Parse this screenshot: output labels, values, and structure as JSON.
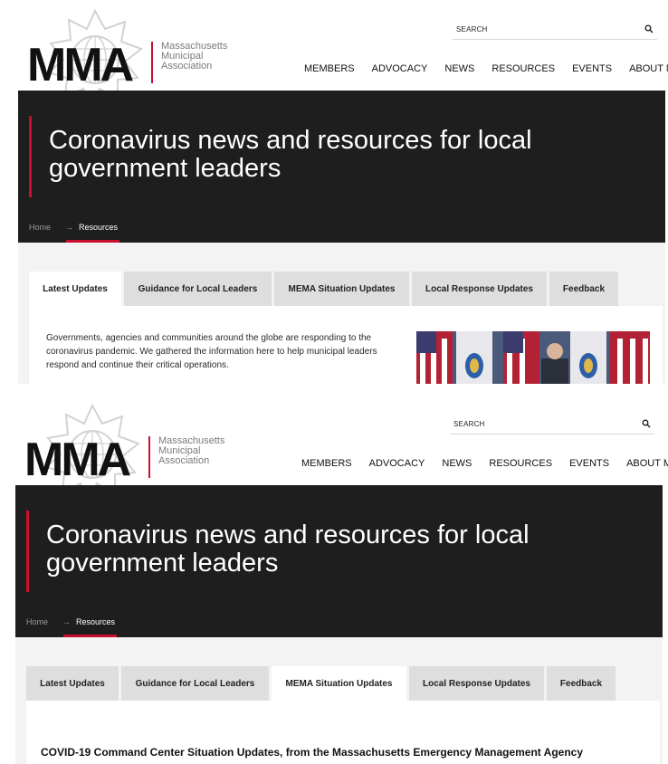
{
  "logo": {
    "mark": "MMA",
    "line1": "Massachusetts",
    "line2": "Municipal",
    "line3": "Association"
  },
  "search": {
    "label": "SEARCH"
  },
  "nav": [
    "MEMBERS",
    "ADVOCACY",
    "NEWS",
    "RESOURCES",
    "EVENTS",
    "ABOUT MMA"
  ],
  "hero": {
    "title": "Coronavirus news and resources for local government leaders"
  },
  "breadcrumb": {
    "home": "Home",
    "separator": "→",
    "current": "Resources"
  },
  "tabs": [
    "Latest Updates",
    "Guidance for Local Leaders",
    "MEMA Situation Updates",
    "Local Response Updates",
    "Feedback"
  ],
  "panels": {
    "latest": {
      "text": "Governments, agencies and communities around the globe are responding to the coronavirus pandemic. We gathered the information here to help municipal leaders respond and continue their critical operations."
    },
    "mema": {
      "heading": "COVID-19 Command Center Situation Updates, from the Massachusetts Emergency Management Agency"
    }
  },
  "colors": {
    "accent": "#c8102e",
    "hero_bg": "#1e1e1e",
    "tab_bg": "#dedede",
    "content_bg": "#f3f3f3"
  }
}
